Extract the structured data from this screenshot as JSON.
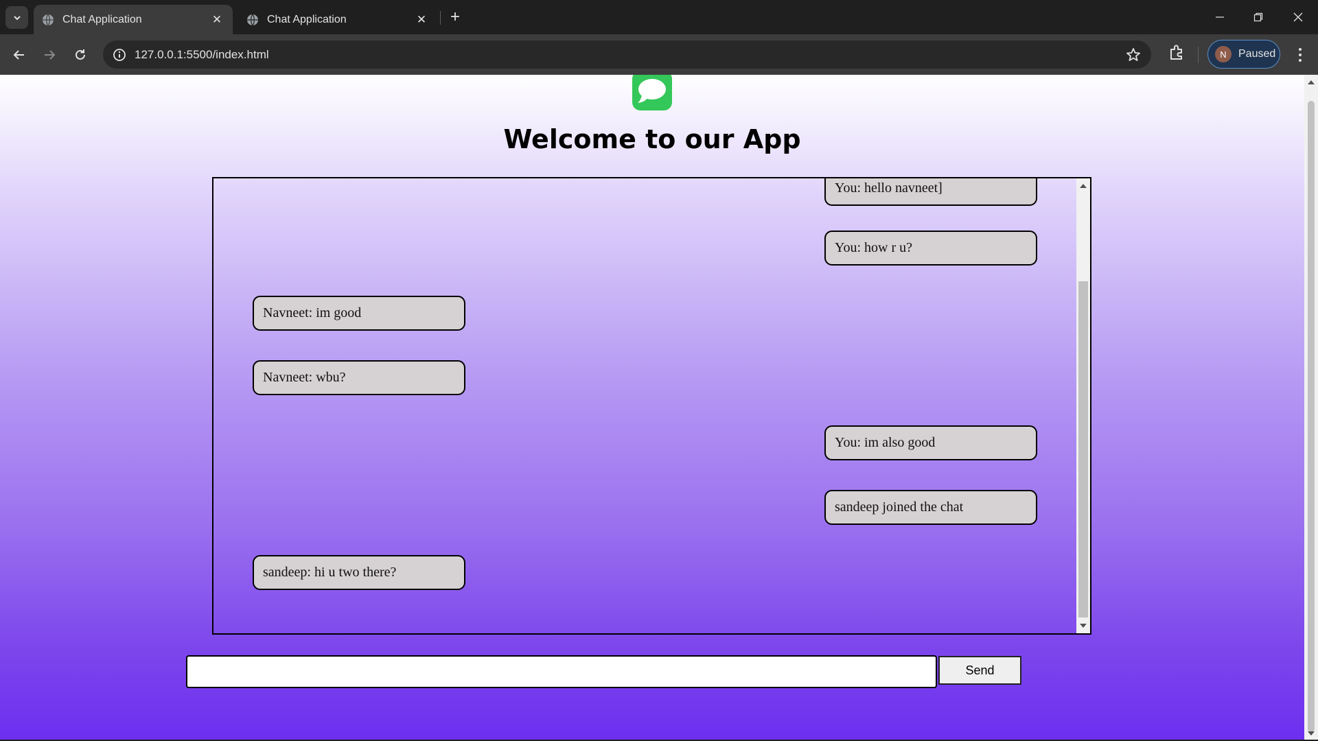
{
  "browser": {
    "tabs": [
      {
        "title": "Chat Application",
        "active": true
      },
      {
        "title": "Chat Application",
        "active": false
      }
    ],
    "url": "127.0.0.1:5500/index.html",
    "profile": {
      "initial": "N",
      "status": "Paused"
    }
  },
  "page": {
    "heading": "Welcome to our App",
    "messages": [
      {
        "text": "You: hello navneet]",
        "side": "right"
      },
      {
        "text": "You: how r u?",
        "side": "right"
      },
      {
        "text": "Navneet: im good",
        "side": "left"
      },
      {
        "text": "Navneet: wbu?",
        "side": "left"
      },
      {
        "text": "You: im also good",
        "side": "right"
      },
      {
        "text": "sandeep joined the chat",
        "side": "right"
      },
      {
        "text": "sandeep: hi u two there?",
        "side": "left"
      }
    ],
    "input_value": "",
    "send_label": "Send"
  },
  "colors": {
    "chrome_dark": "#1f1f1f",
    "chrome_toolbar": "#3c3c3c",
    "bubble": "#d6d1d2",
    "gradient_bottom": "#6d2ff0",
    "logo_green": "#34c759"
  }
}
